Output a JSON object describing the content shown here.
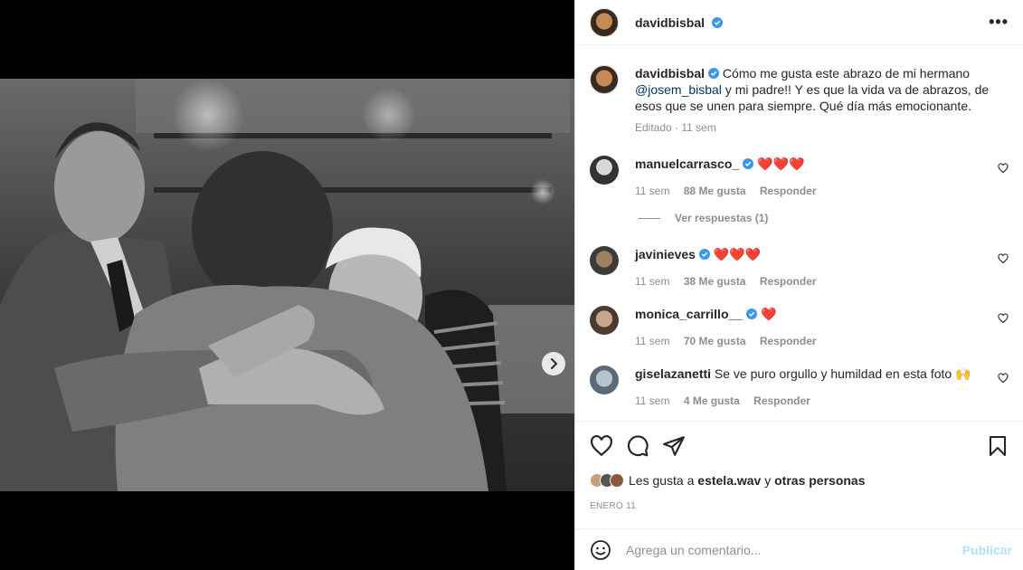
{
  "post": {
    "username": "davidbisbal",
    "caption_prefix": "Cómo me gusta este abrazo de mi hermano ",
    "caption_mention": "@josem_bisbal",
    "caption_suffix": " y mi padre!! Y es que la vida va de abrazos, de esos que se unen para siempre. Qué día más emocionante.",
    "caption_meta": "Editado · 11 sem",
    "more_label": "•••"
  },
  "comments": [
    {
      "username": "manuelcarrasco_",
      "text": "❤️❤️❤️",
      "time": "11 sem",
      "likes": "88 Me gusta",
      "reply": "Responder"
    },
    {
      "username": "javinieves",
      "text": "❤️❤️❤️",
      "time": "11 sem",
      "likes": "38 Me gusta",
      "reply": "Responder"
    },
    {
      "username": "monica_carrillo__",
      "text": "❤️",
      "time": "11 sem",
      "likes": "70 Me gusta",
      "reply": "Responder"
    },
    {
      "username": "giselazanetti",
      "text": "Se ve puro orgullo y humildad en esta foto 🙌",
      "time": "11 sem",
      "likes": "4 Me gusta",
      "reply": "Responder"
    }
  ],
  "view_replies": "Ver respuestas (1)",
  "liked_by": {
    "prefix": "Les gusta a ",
    "user": "estela.wav",
    "middle": " y ",
    "others": "otras personas"
  },
  "date": "ENERO 11",
  "add_comment": {
    "placeholder": "Agrega un comentario...",
    "publish": "Publicar"
  },
  "colors": {
    "verified": "#3897f0",
    "publish_disabled": "#b2dffc",
    "muted": "#8e8e8e"
  },
  "icons": [
    "verified-icon",
    "more-icon",
    "heart-icon",
    "comment-icon",
    "share-icon",
    "bookmark-icon",
    "emoji-icon",
    "chevron-right-icon"
  ]
}
